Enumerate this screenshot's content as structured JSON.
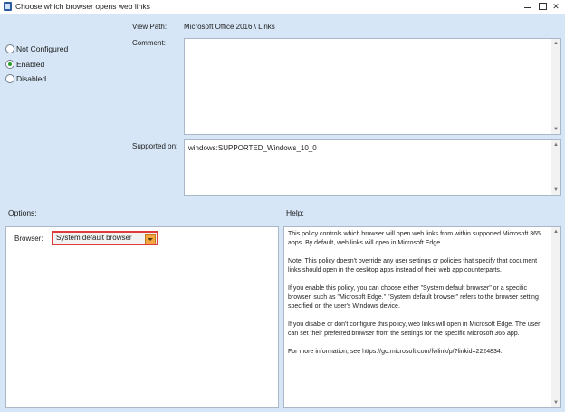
{
  "window": {
    "title": "Choose which browser opens web links",
    "icon": "policy-app-icon",
    "controls": {
      "minimize": "—",
      "maximize": "☐",
      "close": "✕"
    }
  },
  "radios": [
    {
      "label": "Not Configured",
      "checked": false
    },
    {
      "label": "Enabled",
      "checked": true
    },
    {
      "label": "Disabled",
      "checked": false
    }
  ],
  "fields": {
    "view_path_label": "View Path:",
    "view_path_value": "Microsoft Office 2016 \\ Links",
    "comment_label": "Comment:",
    "comment_value": "",
    "supported_on_label": "Supported on:",
    "supported_on_value": "windows:SUPPORTED_Windows_10_0"
  },
  "options": {
    "label": "Options:",
    "browser_label": "Browser:",
    "browser_selected": "System default browser"
  },
  "help": {
    "label": "Help:",
    "paragraphs": [
      "This policy controls which browser will open web links from within supported Microsoft 365 apps. By default, web links will open in Microsoft Edge.",
      "Note: This policy doesn't override any user settings or policies that specify that document links should open in the desktop apps instead of their web app counterparts.",
      "If you enable this policy, you can choose either \"System default browser\" or a specific browser, such as \"Microsoft Edge.\" \"System default browser\" refers to the browser setting specified on the user's Windows device.",
      "If you disable or don't configure this policy, web links will open in Microsoft Edge. The user can set their preferred browser from the settings for the specific Microsoft 365 app.",
      "For more information, see https://go.microsoft.com/fwlink/p/?linkid=2224834."
    ]
  },
  "colors": {
    "background": "#d6e6f6",
    "highlight_border": "#e03a3a",
    "dropdown_arrow": "#f4a640",
    "enabled_radio": "#2a9d2a"
  }
}
